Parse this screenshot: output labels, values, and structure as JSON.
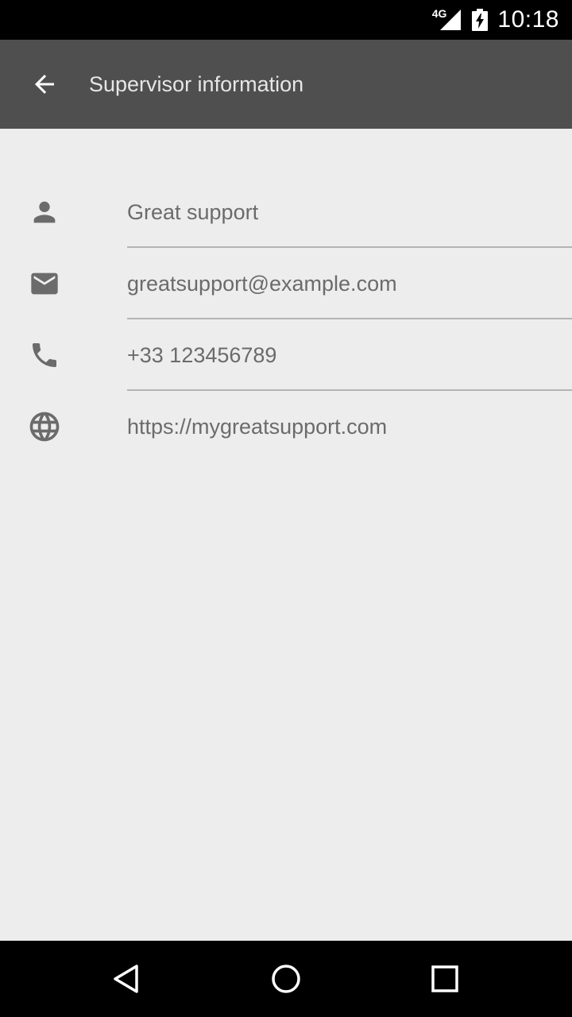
{
  "status_bar": {
    "network_label": "4G",
    "time": "10:18",
    "icons": [
      "signal-icon",
      "battery-charging-icon"
    ]
  },
  "toolbar": {
    "title": "Supervisor information",
    "back_icon": "arrow-back-icon"
  },
  "supervisor": {
    "name": "Great support",
    "email": "greatsupport@example.com",
    "phone": "+33 123456789",
    "website": "https://mygreatsupport.com"
  },
  "row_icons": [
    "person-icon",
    "email-icon",
    "phone-icon",
    "globe-icon"
  ],
  "nav_bar": {
    "icons": [
      "nav-back-icon",
      "nav-home-icon",
      "nav-recents-icon"
    ]
  },
  "colors": {
    "toolbar": "#4f4f4f",
    "background": "#ededed",
    "text": "#6b6b6b",
    "icon": "#6b6b6b",
    "divider": "#b4b4b4"
  }
}
